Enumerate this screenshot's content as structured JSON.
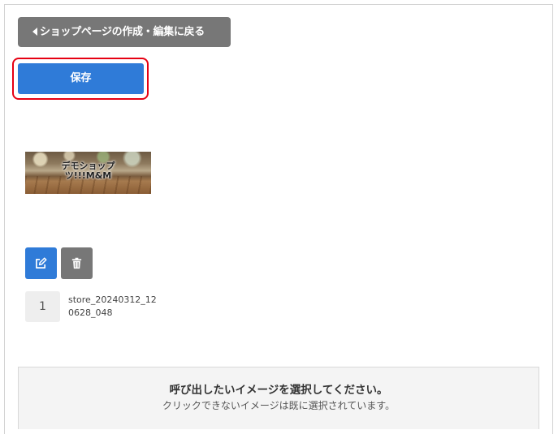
{
  "toolbar": {
    "back_label": "ショップページの作成・編集に戻る",
    "save_label": "保存"
  },
  "image_item": {
    "thumbnail_caption_line1": "デモショップ",
    "thumbnail_caption_line2": "ツ!!!M&M",
    "index": "1",
    "filename": "store_20240312_120628_048",
    "edit_icon": "edit-icon",
    "delete_icon": "trash-icon"
  },
  "picker": {
    "title": "呼び出したいイメージを選択してください。",
    "subtitle": "クリックできないイメージは既に選択されています。"
  },
  "colors": {
    "primary": "#2f7bd8",
    "secondary": "#777777",
    "highlight": "#e60012"
  }
}
